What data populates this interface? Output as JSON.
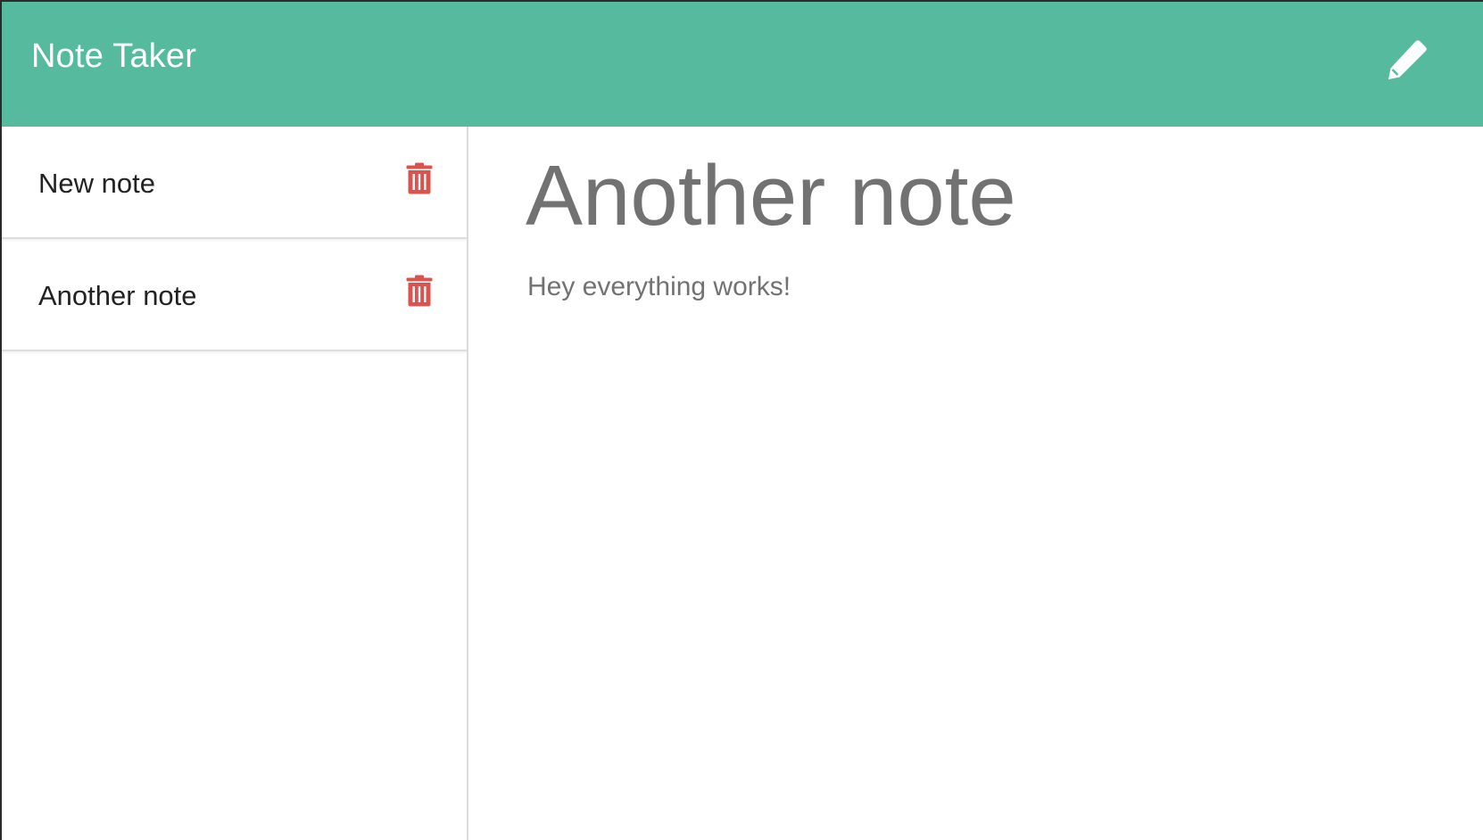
{
  "app": {
    "brand": "Note Taker"
  },
  "notes": [
    {
      "title": "New note"
    },
    {
      "title": "Another note"
    }
  ],
  "active_note": {
    "title": "Another note",
    "text": "Hey everything works!"
  },
  "icons": {
    "new_note": "pencil-icon",
    "delete": "trash-icon"
  },
  "colors": {
    "navbar": "#56bb9e",
    "delete_icon": "#d9534f",
    "note_text": "#727272"
  }
}
